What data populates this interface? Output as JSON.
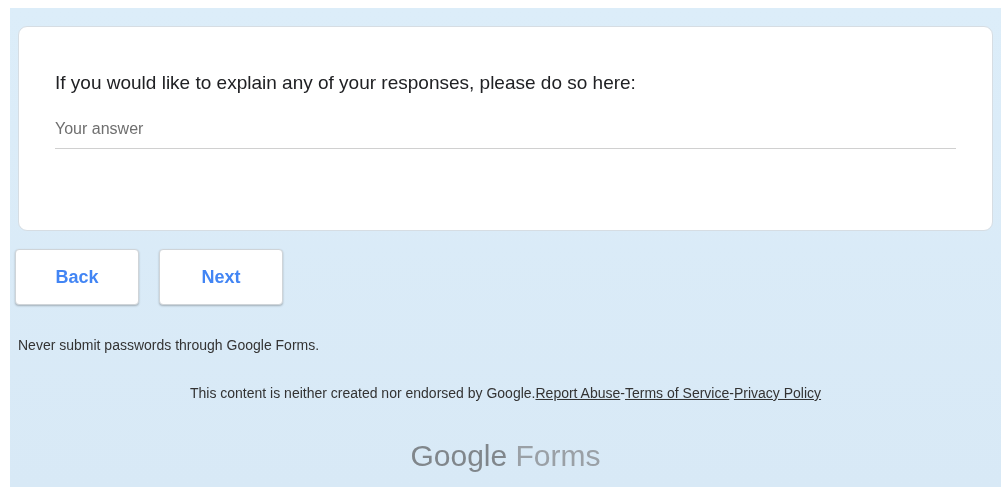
{
  "question": {
    "title": "If you would like to explain any of your responses, please do so here:",
    "placeholder": "Your answer"
  },
  "buttons": [
    {
      "label": "Back"
    },
    {
      "label": "Next"
    }
  ],
  "password_warning": "Never submit passwords through Google Forms.",
  "footer": {
    "text": "This content is neither created nor endorsed by Google.",
    "separator": "-",
    "links": [
      "Report Abuse",
      "Terms of Service",
      "Privacy Policy"
    ]
  },
  "logo": {
    "brand": "Google",
    "product": "Forms"
  }
}
